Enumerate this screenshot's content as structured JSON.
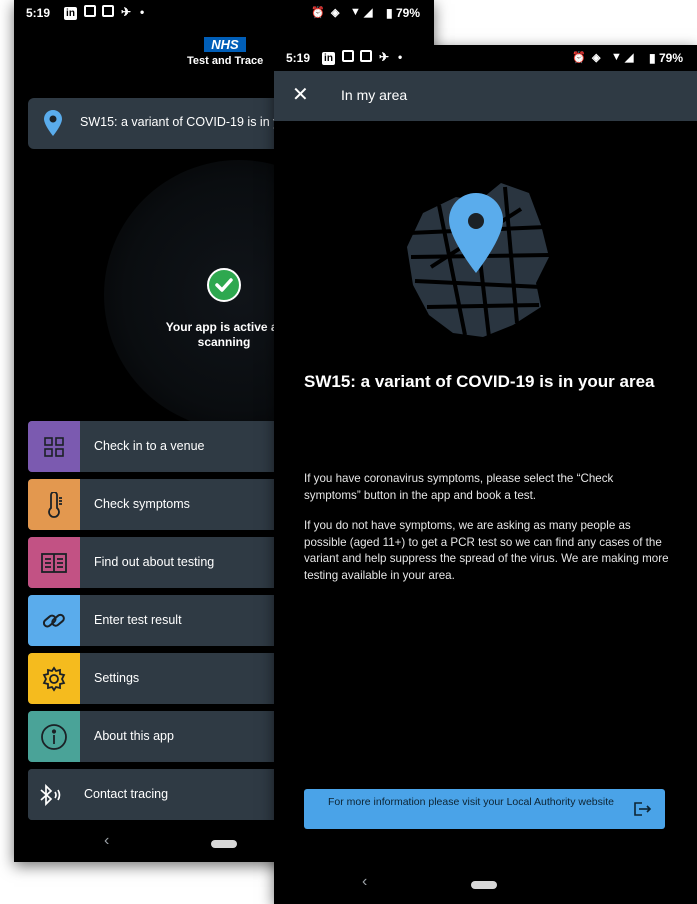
{
  "back_screen": {
    "status_bar": {
      "time": "5:19",
      "battery": "79%"
    },
    "header": {
      "logo": "NHS",
      "subtitle": "Test and Trace"
    },
    "banner": {
      "icon": "location-pin-icon",
      "text": "SW15: a variant of COVID-19 is in you"
    },
    "status": {
      "icon": "check-circle-icon",
      "text": "Your app is active ar scanning"
    },
    "menu": [
      {
        "label": "Check in to a venue",
        "icon": "qr-code-icon",
        "color": "#7b5ab0"
      },
      {
        "label": "Check symptoms",
        "icon": "thermometer-icon",
        "color": "#e3984f"
      },
      {
        "label": "Find out about testing",
        "icon": "book-icon",
        "color": "#c25284"
      },
      {
        "label": "Enter test result",
        "icon": "link-icon",
        "color": "#5aacec"
      },
      {
        "label": "Settings",
        "icon": "gear-icon",
        "color": "#f5bb1e"
      },
      {
        "label": "About this app",
        "icon": "info-icon",
        "color": "#4aa398"
      },
      {
        "label": "Contact tracing",
        "icon": "bluetooth-icon",
        "color": "#2f3a44"
      }
    ],
    "nav": {
      "back": "‹"
    }
  },
  "front_screen": {
    "status_bar": {
      "time": "5:19",
      "battery": "79%"
    },
    "toolbar": {
      "close": "✕",
      "title": "In my area"
    },
    "headline": "SW15: a variant of COVID-19 is in your area",
    "paragraphs": [
      "If you have coronavirus symptoms, please select the “Check symptoms” button in the app and book a test.",
      "If you do not have symptoms, we are asking as many people as possible (aged 11+) to get a PCR test so we can find any cases of the variant and help suppress the spread of the virus. We are making more testing available in your area."
    ],
    "cta": {
      "label": "For more information please visit your Local Authority website",
      "icon": "external-link-icon",
      "color": "#4aa3e8"
    },
    "nav": {
      "back": "‹"
    }
  }
}
